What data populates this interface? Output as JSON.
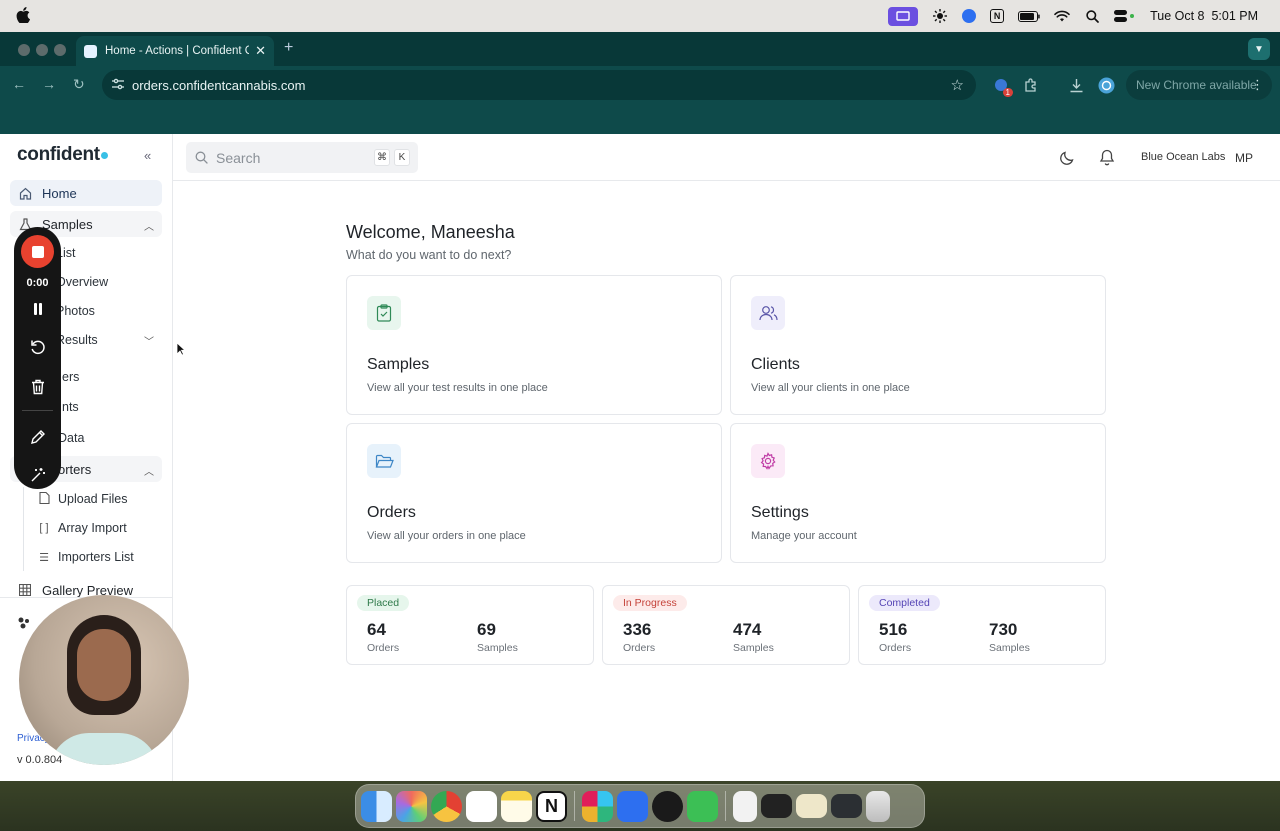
{
  "menubar": {
    "datetime": "Tue Oct 8  5:01 PM"
  },
  "browser": {
    "tab_title": "Home - Actions | Confident C",
    "tab_close": "✕",
    "new_tab": "+",
    "url": "orders.confidentcannabis.com",
    "extension_badge": "1",
    "new_chrome": "New Chrome available"
  },
  "app": {
    "logo": "confident",
    "sidebar": {
      "home": "Home",
      "samples": "Samples",
      "list": "List",
      "overview": "Overview",
      "photos": "Photos",
      "results": "Results",
      "orders_partial": "ers",
      "clients_partial": "nts",
      "data_partial": "Data",
      "importers_partial": "orters",
      "upload_files": "Upload Files",
      "array_import": "Array Import",
      "array_icon": "[ ]",
      "importers_list": "Importers List",
      "gallery_preview": "Gallery Preview",
      "privacy": "Privacy",
      "version": "v 0.0.804"
    },
    "topbar": {
      "search_placeholder": "Search",
      "kbd_cmd": "⌘",
      "kbd_k": "K",
      "org": "Blue Ocean Labs",
      "avatar": "MP"
    },
    "welcome": "Welcome, Maneesha",
    "subtitle": "What do you want to do next?",
    "cards": [
      {
        "title": "Samples",
        "desc": "View all your test results in one place",
        "icon": "clipboard-check-icon",
        "color": "#e8f6ee"
      },
      {
        "title": "Clients",
        "desc": "View all your clients in one place",
        "icon": "users-icon",
        "color": "#efeefb"
      },
      {
        "title": "Orders",
        "desc": "View all your orders in one place",
        "icon": "folder-open-icon",
        "color": "#e7f2fb"
      },
      {
        "title": "Settings",
        "desc": "Manage your account",
        "icon": "gear-icon",
        "color": "#fbeaf7"
      }
    ],
    "stats": [
      {
        "badge": "Placed",
        "orders": "64",
        "samples": "69",
        "bg": "#e6f6ec",
        "fg": "#2f7a4a"
      },
      {
        "badge": "In Progress",
        "orders": "336",
        "samples": "474",
        "bg": "#fdebea",
        "fg": "#c5433a"
      },
      {
        "badge": "Completed",
        "orders": "516",
        "samples": "730",
        "bg": "#ece9fb",
        "fg": "#5544b5"
      }
    ],
    "stat_labels": {
      "orders": "Orders",
      "samples": "Samples"
    }
  },
  "recorder": {
    "timer": "0:00"
  }
}
